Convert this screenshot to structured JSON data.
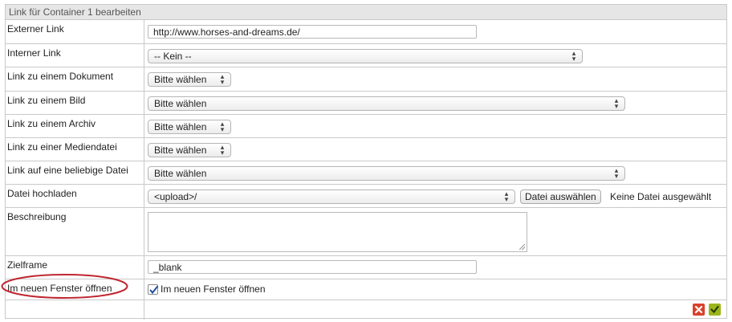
{
  "dialog": {
    "title": "Link für Container 1 bearbeiten"
  },
  "fields": {
    "externer_link": {
      "label": "Externer Link",
      "value": "http://www.horses-and-dreams.de/"
    },
    "interner_link": {
      "label": "Interner Link",
      "selected": "-- Kein --"
    },
    "dokument": {
      "label": "Link zu einem Dokument",
      "selected": "Bitte wählen"
    },
    "bild": {
      "label": "Link zu einem Bild",
      "selected": "Bitte wählen"
    },
    "archiv": {
      "label": "Link zu einem Archiv",
      "selected": "Bitte wählen"
    },
    "mediendatei": {
      "label": "Link zu einer Mediendatei",
      "selected": "Bitte wählen"
    },
    "beliebige_datei": {
      "label": "Link auf eine beliebige Datei",
      "selected": "Bitte wählen"
    },
    "upload": {
      "label": "Datei hochladen",
      "selected": "<upload>/",
      "button": "Datei auswählen",
      "status": "Keine Datei ausgewählt"
    },
    "beschreibung": {
      "label": "Beschreibung",
      "value": ""
    },
    "zielframe": {
      "label": "Zielframe",
      "value": "_blank"
    },
    "neues_fenster": {
      "label": "Im neuen Fenster öffnen",
      "checkbox_label": "Im neuen Fenster öffnen",
      "checked": true
    }
  },
  "actions": {
    "cancel_icon": "close-icon",
    "confirm_icon": "checkmark-icon"
  },
  "colors": {
    "annotation_ellipse": "#c0262f",
    "cancel": "#d9412b",
    "confirm": "#9bb51c"
  }
}
